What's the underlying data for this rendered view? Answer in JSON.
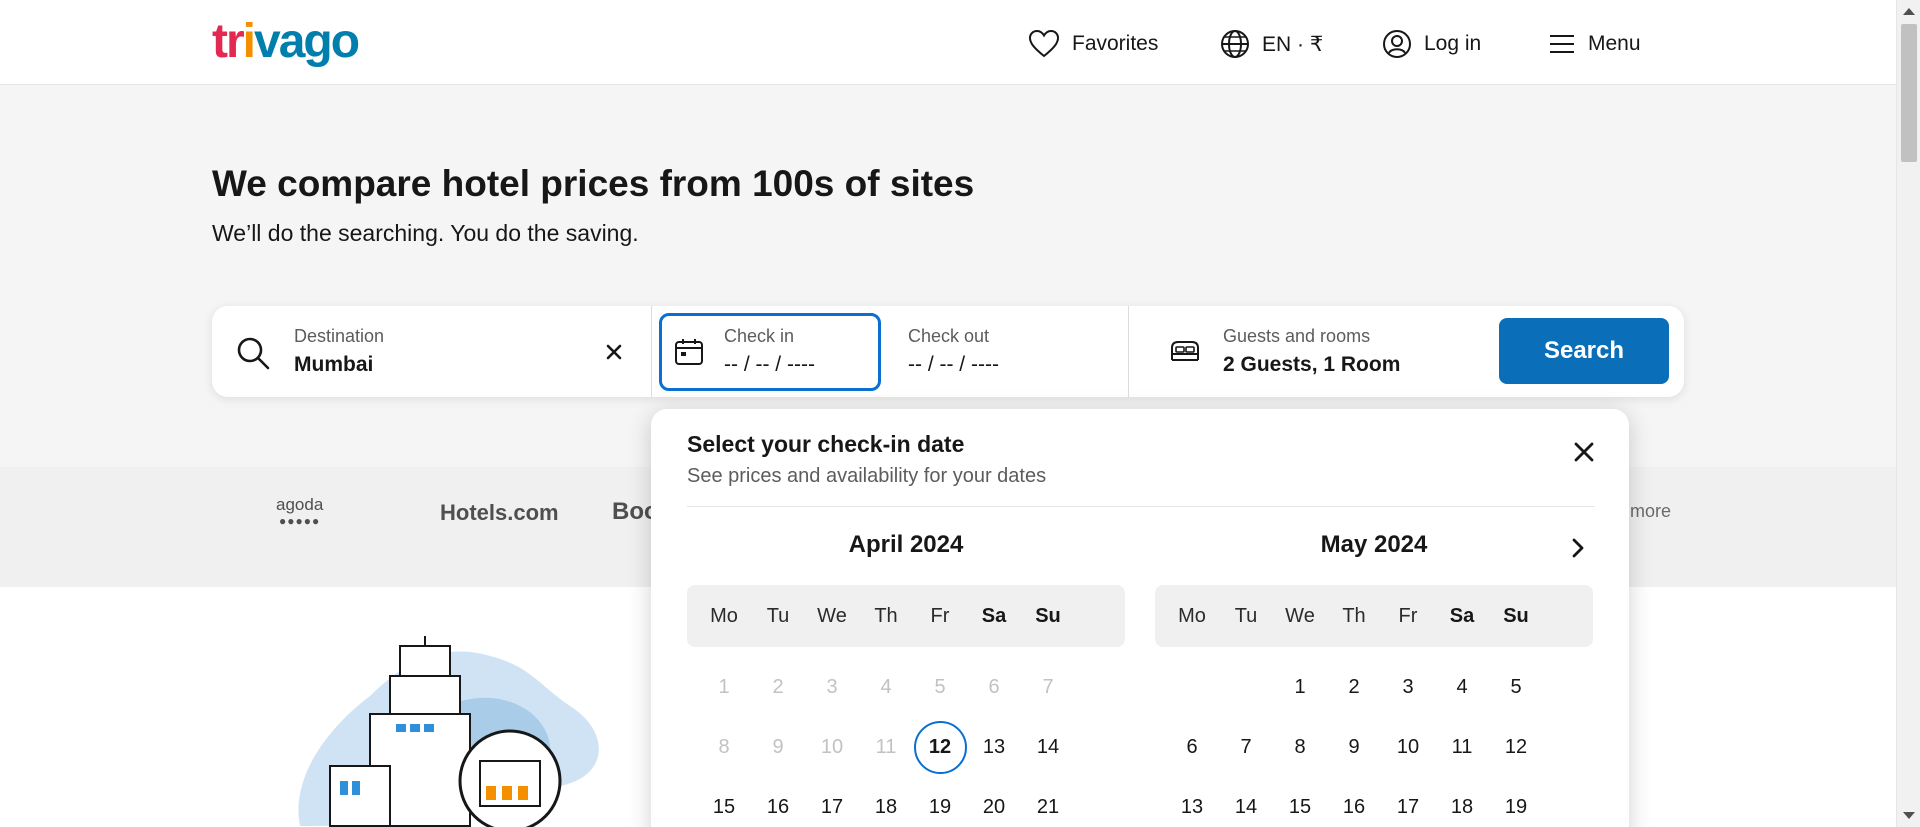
{
  "header": {
    "logo_text": "trivago",
    "favorites_label": "Favorites",
    "language_label": "EN · ₹",
    "login_label": "Log in",
    "menu_label": "Menu"
  },
  "hero": {
    "title": "We compare hotel prices from 100s of sites",
    "subtitle": "We’ll do the searching. You do the saving."
  },
  "search": {
    "destination_label": "Destination",
    "destination_value": "Mumbai",
    "checkin_label": "Check in",
    "checkin_value": "-- / -- / ----",
    "checkout_label": "Check out",
    "checkout_value": "-- / -- / ----",
    "guests_label": "Guests and rooms",
    "guests_value": "2 Guests, 1 Room",
    "button_label": "Search"
  },
  "partners": {
    "agoda": "agoda",
    "agoda_dots": "●●●●●",
    "hotels": "Hotels.com",
    "booking": "Boo",
    "more": "more"
  },
  "calendar": {
    "title": "Select your check-in date",
    "subtitle": "See prices and availability for your dates",
    "weekdays": [
      "Mo",
      "Tu",
      "We",
      "Th",
      "Fr",
      "Sa",
      "Su"
    ],
    "months": [
      {
        "name": "April 2024",
        "offset": 0,
        "days": [
          "1",
          "2",
          "3",
          "4",
          "5",
          "6",
          "7",
          "8",
          "9",
          "10",
          "11",
          "12",
          "13",
          "14",
          "15",
          "16",
          "17",
          "18",
          "19",
          "20",
          "21"
        ],
        "past_through": 11,
        "today": 12
      },
      {
        "name": "May 2024",
        "offset": 2,
        "days": [
          "1",
          "2",
          "3",
          "4",
          "5",
          "6",
          "7",
          "8",
          "9",
          "10",
          "11",
          "12",
          "13",
          "14",
          "15",
          "16",
          "17",
          "18",
          "19"
        ],
        "past_through": 0,
        "today": 0
      }
    ]
  },
  "colors": {
    "brand_red": "#e32851",
    "brand_orange": "#f48f00",
    "brand_blue": "#007fad",
    "accent_blue": "#0a6fd1",
    "search_button": "#0a6fb8"
  }
}
